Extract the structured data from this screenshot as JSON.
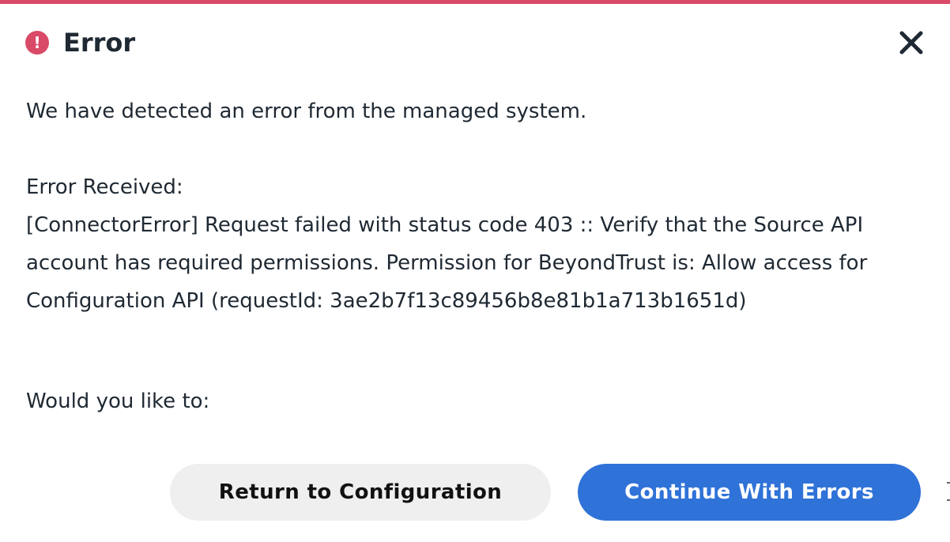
{
  "dialog": {
    "title": "Error",
    "accent_color": "#d94a68",
    "icon": "exclamation-circle-icon",
    "close_icon": "close-icon",
    "intro": "We have detected an error from the managed system.",
    "received_label": "Error Received:",
    "error_message": "[ConnectorError] Request failed with status code 403 :: Verify that the Source API account has required permissions. Permission for BeyondTrust is: Allow access for Configuration API (requestId: 3ae2b7f13c89456b8e81b1a713b1651d)",
    "question": "Would you like to:"
  },
  "buttons": {
    "return_label": "Return to Configuration",
    "continue_label": "Continue With Errors",
    "continue_color": "#2f72d8",
    "return_color": "#efefef"
  }
}
